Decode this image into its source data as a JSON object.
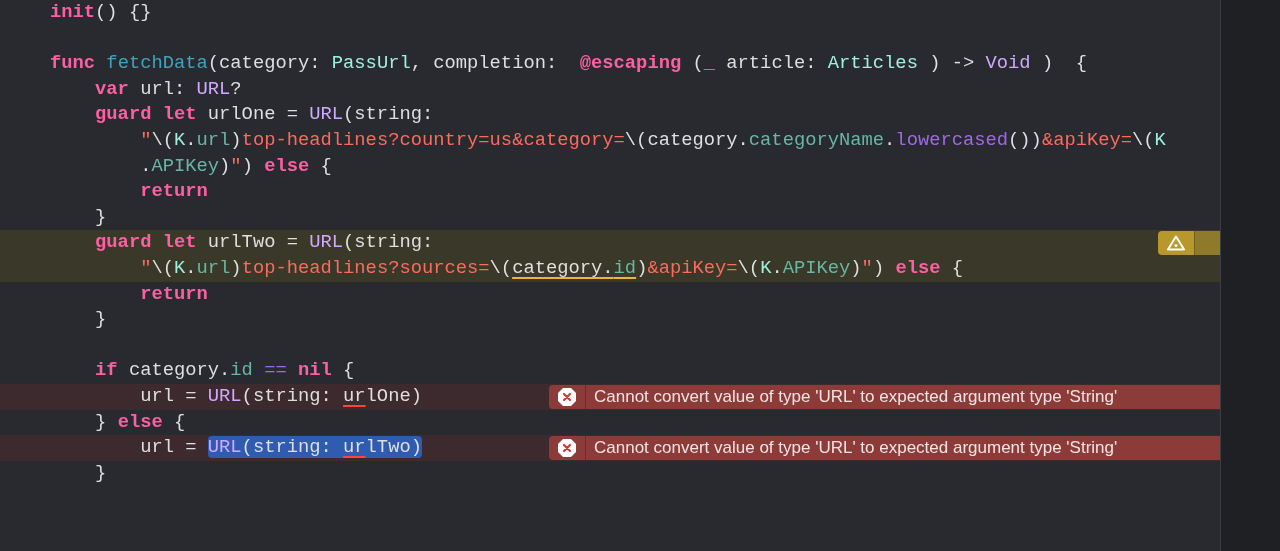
{
  "editor": {
    "lines": [
      {
        "kind": "code",
        "warning": false,
        "error": false,
        "rows": [
          {
            "tokens": [
              {
                "text": "init",
                "kind": "keyword"
              },
              {
                "text": "() {}",
                "kind": "plain"
              }
            ]
          }
        ]
      },
      {
        "kind": "blank",
        "warning": false,
        "error": false
      },
      {
        "kind": "code",
        "warning": false,
        "error": false,
        "rows": [
          {
            "tokens": [
              {
                "text": "func",
                "kind": "keyword"
              },
              {
                "text": " fetchData",
                "kind": "declaration"
              },
              {
                "text": "(category: ",
                "kind": "plain"
              },
              {
                "text": "PassUrl",
                "kind": "project_type"
              },
              {
                "text": ", completion:  ",
                "kind": "plain"
              },
              {
                "text": "@escaping",
                "kind": "keyword"
              },
              {
                "text": " (",
                "kind": "plain"
              },
              {
                "text": "_",
                "kind": "keyword"
              },
              {
                "text": " article: ",
                "kind": "plain"
              },
              {
                "text": "Articles",
                "kind": "project_type"
              },
              {
                "text": " ) -> ",
                "kind": "plain"
              },
              {
                "text": "Void",
                "kind": "system_type"
              },
              {
                "text": " )  {",
                "kind": "plain"
              }
            ]
          }
        ]
      },
      {
        "kind": "code",
        "warning": false,
        "error": false,
        "rows": [
          {
            "tokens": [
              {
                "text": "    var",
                "kind": "keyword"
              },
              {
                "text": " url: ",
                "kind": "plain"
              },
              {
                "text": "URL",
                "kind": "system_type"
              },
              {
                "text": "?",
                "kind": "plain"
              }
            ]
          }
        ]
      },
      {
        "kind": "code",
        "warning": false,
        "error": false,
        "rows": [
          {
            "tokens": [
              {
                "text": "    guard",
                "kind": "keyword"
              },
              {
                "text": " let",
                "kind": "keyword"
              },
              {
                "text": " urlOne = ",
                "kind": "plain"
              },
              {
                "text": "URL",
                "kind": "system_type"
              },
              {
                "text": "(string:",
                "kind": "plain"
              }
            ]
          },
          {
            "tokens": [
              {
                "text": "        \"",
                "kind": "string"
              },
              {
                "text": "\\(",
                "kind": "plain"
              },
              {
                "text": "K",
                "kind": "project_type"
              },
              {
                "text": ".",
                "kind": "plain"
              },
              {
                "text": "url",
                "kind": "project_member"
              },
              {
                "text": ")",
                "kind": "plain"
              },
              {
                "text": "top-headlines?country=us&category=",
                "kind": "string"
              },
              {
                "text": "\\(category.",
                "kind": "plain"
              },
              {
                "text": "categoryName",
                "kind": "project_member"
              },
              {
                "text": ".",
                "kind": "plain"
              },
              {
                "text": "lowercased",
                "kind": "system_member"
              },
              {
                "text": "())",
                "kind": "plain"
              },
              {
                "text": "&apiKey=",
                "kind": "string"
              },
              {
                "text": "\\(",
                "kind": "plain"
              },
              {
                "text": "K",
                "kind": "project_type"
              }
            ]
          },
          {
            "tokens": [
              {
                "text": "        .",
                "kind": "plain"
              },
              {
                "text": "APIKey",
                "kind": "project_member"
              },
              {
                "text": ")",
                "kind": "plain"
              },
              {
                "text": "\"",
                "kind": "string"
              },
              {
                "text": ") ",
                "kind": "plain"
              },
              {
                "text": "else",
                "kind": "keyword"
              },
              {
                "text": " {",
                "kind": "plain"
              }
            ]
          }
        ]
      },
      {
        "kind": "code",
        "warning": false,
        "error": false,
        "rows": [
          {
            "tokens": [
              {
                "text": "        return",
                "kind": "keyword"
              }
            ]
          }
        ]
      },
      {
        "kind": "code",
        "warning": false,
        "error": false,
        "rows": [
          {
            "tokens": [
              {
                "text": "    }",
                "kind": "plain"
              }
            ]
          }
        ]
      },
      {
        "kind": "code",
        "warning": true,
        "error": false,
        "rows": [
          {
            "tokens": [
              {
                "text": "    guard",
                "kind": "keyword"
              },
              {
                "text": " let",
                "kind": "keyword"
              },
              {
                "text": " urlTwo = ",
                "kind": "plain"
              },
              {
                "text": "URL",
                "kind": "system_type"
              },
              {
                "text": "(string:",
                "kind": "plain"
              }
            ]
          },
          {
            "tokens": [
              {
                "text": "        \"",
                "kind": "string"
              },
              {
                "text": "\\(",
                "kind": "plain"
              },
              {
                "text": "K",
                "kind": "project_type"
              },
              {
                "text": ".",
                "kind": "plain"
              },
              {
                "text": "url",
                "kind": "project_member"
              },
              {
                "text": ")",
                "kind": "plain"
              },
              {
                "text": "top-headlines?sources=",
                "kind": "string"
              },
              {
                "text": "\\(",
                "kind": "plain"
              },
              {
                "text": "category.",
                "kind": "plain",
                "warning_underline": true
              },
              {
                "text": "id",
                "kind": "project_member",
                "warning_underline": true
              },
              {
                "text": ")",
                "kind": "plain"
              },
              {
                "text": "&apiKey=",
                "kind": "string"
              },
              {
                "text": "\\(",
                "kind": "plain"
              },
              {
                "text": "K",
                "kind": "project_type"
              },
              {
                "text": ".",
                "kind": "plain"
              },
              {
                "text": "APIKey",
                "kind": "project_member"
              },
              {
                "text": ")",
                "kind": "plain"
              },
              {
                "text": "\"",
                "kind": "string"
              },
              {
                "text": ") ",
                "kind": "plain"
              },
              {
                "text": "else",
                "kind": "keyword"
              },
              {
                "text": " {",
                "kind": "plain"
              }
            ]
          }
        ]
      },
      {
        "kind": "code",
        "warning": false,
        "error": false,
        "rows": [
          {
            "tokens": [
              {
                "text": "        return",
                "kind": "keyword"
              }
            ]
          }
        ]
      },
      {
        "kind": "code",
        "warning": false,
        "error": false,
        "rows": [
          {
            "tokens": [
              {
                "text": "    }",
                "kind": "plain"
              }
            ]
          }
        ]
      },
      {
        "kind": "blank",
        "warning": false,
        "error": false
      },
      {
        "kind": "code",
        "warning": false,
        "error": false,
        "rows": [
          {
            "tokens": [
              {
                "text": "    if",
                "kind": "keyword"
              },
              {
                "text": " category.",
                "kind": "plain"
              },
              {
                "text": "id",
                "kind": "project_member"
              },
              {
                "text": " ==",
                "kind": "operator"
              },
              {
                "text": " nil",
                "kind": "keyword"
              },
              {
                "text": " {",
                "kind": "plain"
              }
            ]
          }
        ]
      },
      {
        "kind": "code",
        "warning": false,
        "error": true,
        "message": "Cannot convert value of type 'URL' to expected argument type 'String'",
        "rows": [
          {
            "tokens": [
              {
                "text": "        url = ",
                "kind": "plain"
              },
              {
                "text": "URL",
                "kind": "system_type"
              },
              {
                "text": "(string: ",
                "kind": "plain"
              },
              {
                "text": "ur",
                "kind": "plain",
                "error_underline": true
              },
              {
                "text": "lOne)",
                "kind": "plain"
              }
            ]
          }
        ]
      },
      {
        "kind": "code",
        "warning": false,
        "error": false,
        "rows": [
          {
            "tokens": [
              {
                "text": "    } ",
                "kind": "plain"
              },
              {
                "text": "else",
                "kind": "keyword"
              },
              {
                "text": " {",
                "kind": "plain"
              }
            ]
          }
        ]
      },
      {
        "kind": "code",
        "warning": false,
        "error": true,
        "message": "Cannot convert value of type 'URL' to expected argument type 'String'",
        "rows": [
          {
            "tokens": [
              {
                "text": "        url = ",
                "kind": "plain"
              },
              {
                "kind": "selection",
                "children": [
                  {
                    "text": "URL",
                    "kind": "system_type"
                  },
                  {
                    "text": "(string: ",
                    "kind": "plain"
                  },
                  {
                    "text": "ur",
                    "kind": "plain",
                    "error_underline": true
                  },
                  {
                    "text": "lTwo)",
                    "kind": "plain"
                  }
                ]
              }
            ]
          }
        ]
      },
      {
        "kind": "code",
        "warning": false,
        "error": false,
        "rows": [
          {
            "tokens": [
              {
                "text": "    }",
                "kind": "plain"
              }
            ]
          }
        ]
      }
    ]
  }
}
